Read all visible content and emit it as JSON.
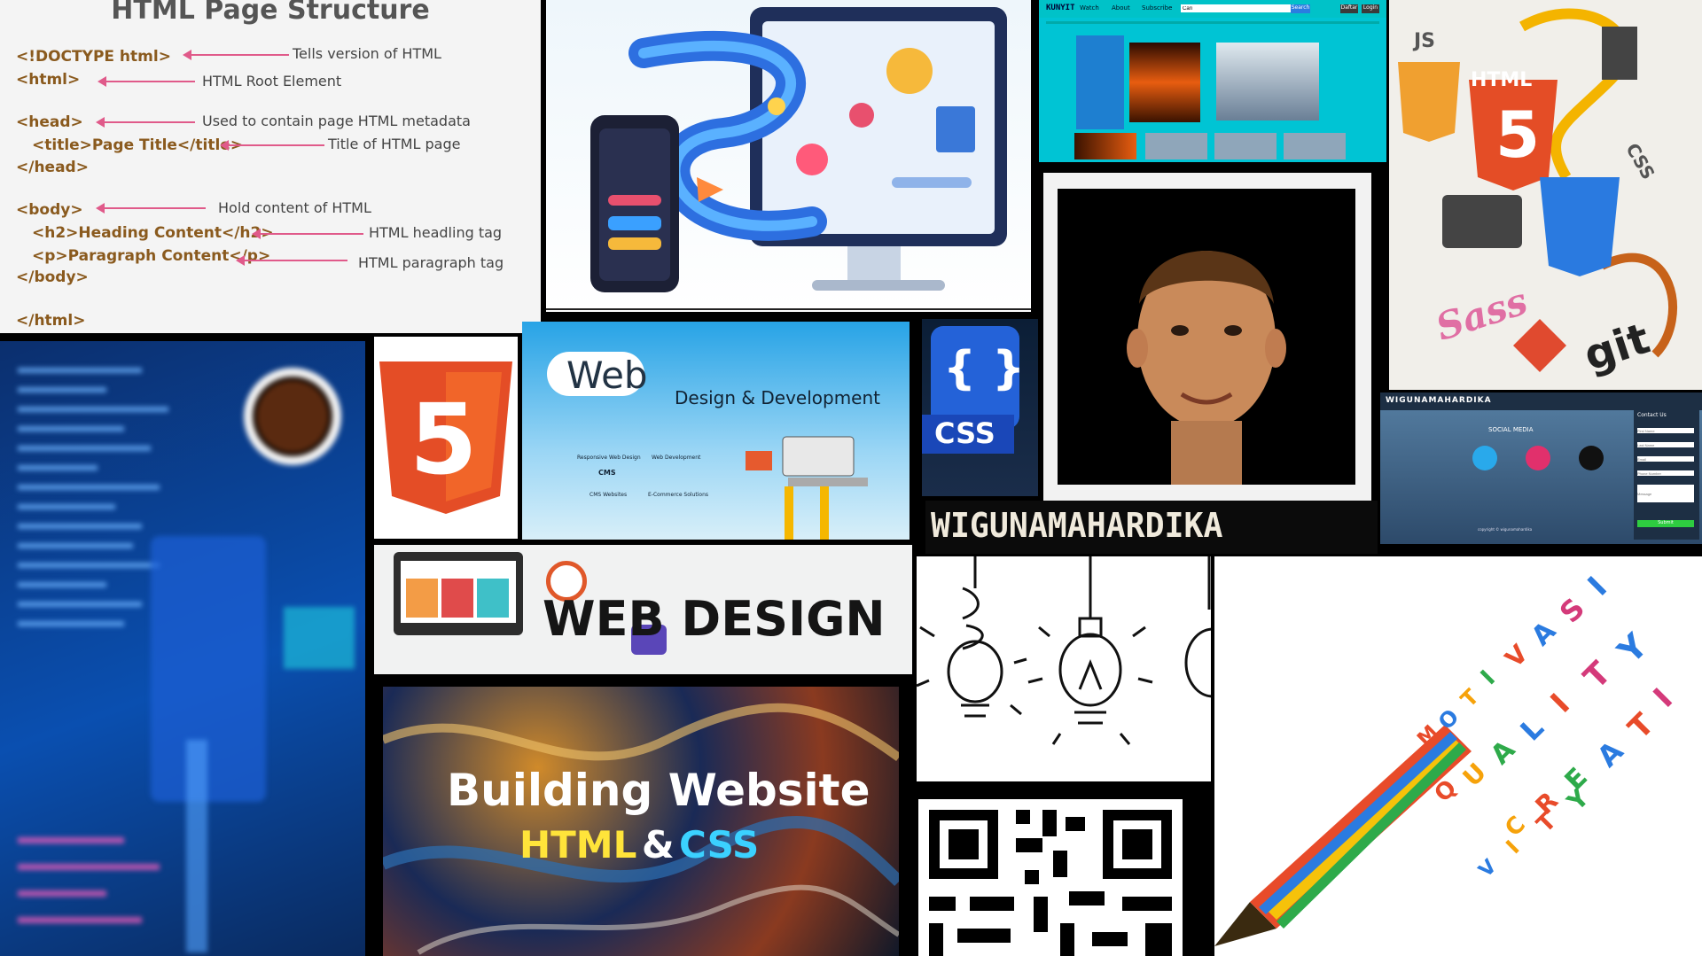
{
  "structure": {
    "title": "HTML Page Structure",
    "lines": [
      {
        "code": "<!DOCTYPE html>",
        "note": "Tells version of HTML"
      },
      {
        "code": "<html>",
        "note": "HTML Root Element"
      },
      {
        "code": "<head>",
        "note": "Used to contain  page HTML metadata"
      },
      {
        "code": "<title>Page Title</title>",
        "note": "Title of HTML page"
      },
      {
        "code": "</head>",
        "note": ""
      },
      {
        "code": "<body>",
        "note": "Hold content of HTML"
      },
      {
        "code": "<h2>Heading Content</h2>",
        "note": "HTML headling tag"
      },
      {
        "code": "<p>Paragraph Content</p>",
        "note": "HTML paragraph tag"
      },
      {
        "code": "</body>",
        "note": ""
      },
      {
        "code": "</html>",
        "note": ""
      }
    ]
  },
  "kunyit": {
    "brand": "KUNYIT",
    "nav": [
      "Watch",
      "About",
      "Subscribe"
    ],
    "search_value": "Cari",
    "search_button": "Search",
    "buttons": [
      "Daftar",
      "Login"
    ]
  },
  "html5_logo": {
    "glyph": "5"
  },
  "webdev": {
    "word": "Web",
    "tagline": "Design & Development",
    "services": [
      "Responsive Web Design",
      "Web Development",
      "CMS",
      "CMS Websites",
      "E-Commerce Solutions"
    ]
  },
  "css_icon": {
    "braces": "{ }",
    "label": "CSS"
  },
  "stack_collage": {
    "labels": [
      "JS",
      "HTML",
      "5",
      "CSS",
      "Sass",
      "git"
    ]
  },
  "banner": {
    "text": "WIGUNAMAHARDIKA"
  },
  "contact": {
    "brand": "WIGUNAMAHARDIKA",
    "section": "SOCIAL MEDIA",
    "form_title": "Contact Us",
    "fields": [
      "First Name",
      "Last Name",
      "Email",
      "Phone Number",
      "Message"
    ],
    "submit": "Submit",
    "footer": "copyright © wigunamahardika"
  },
  "webdesign": {
    "text": "WEB DESIGN"
  },
  "building": {
    "line1": "Building Website",
    "html": "HTML",
    "amp": "&",
    "css": "CSS"
  },
  "pencil": {
    "letters": [
      "M",
      "O",
      "T",
      "I",
      "V",
      "A",
      "S",
      "I",
      "Q",
      "U",
      "A",
      "L",
      "I",
      "T",
      "Y",
      "C",
      "R",
      "E",
      "A",
      "T",
      "I",
      "V",
      "I",
      "T",
      "Y"
    ]
  },
  "colors": {
    "black": "#000000",
    "html_orange": "#e44d26",
    "css_blue": "#264de4",
    "yellow": "#ffd400",
    "cyan": "#3bd1ff"
  }
}
